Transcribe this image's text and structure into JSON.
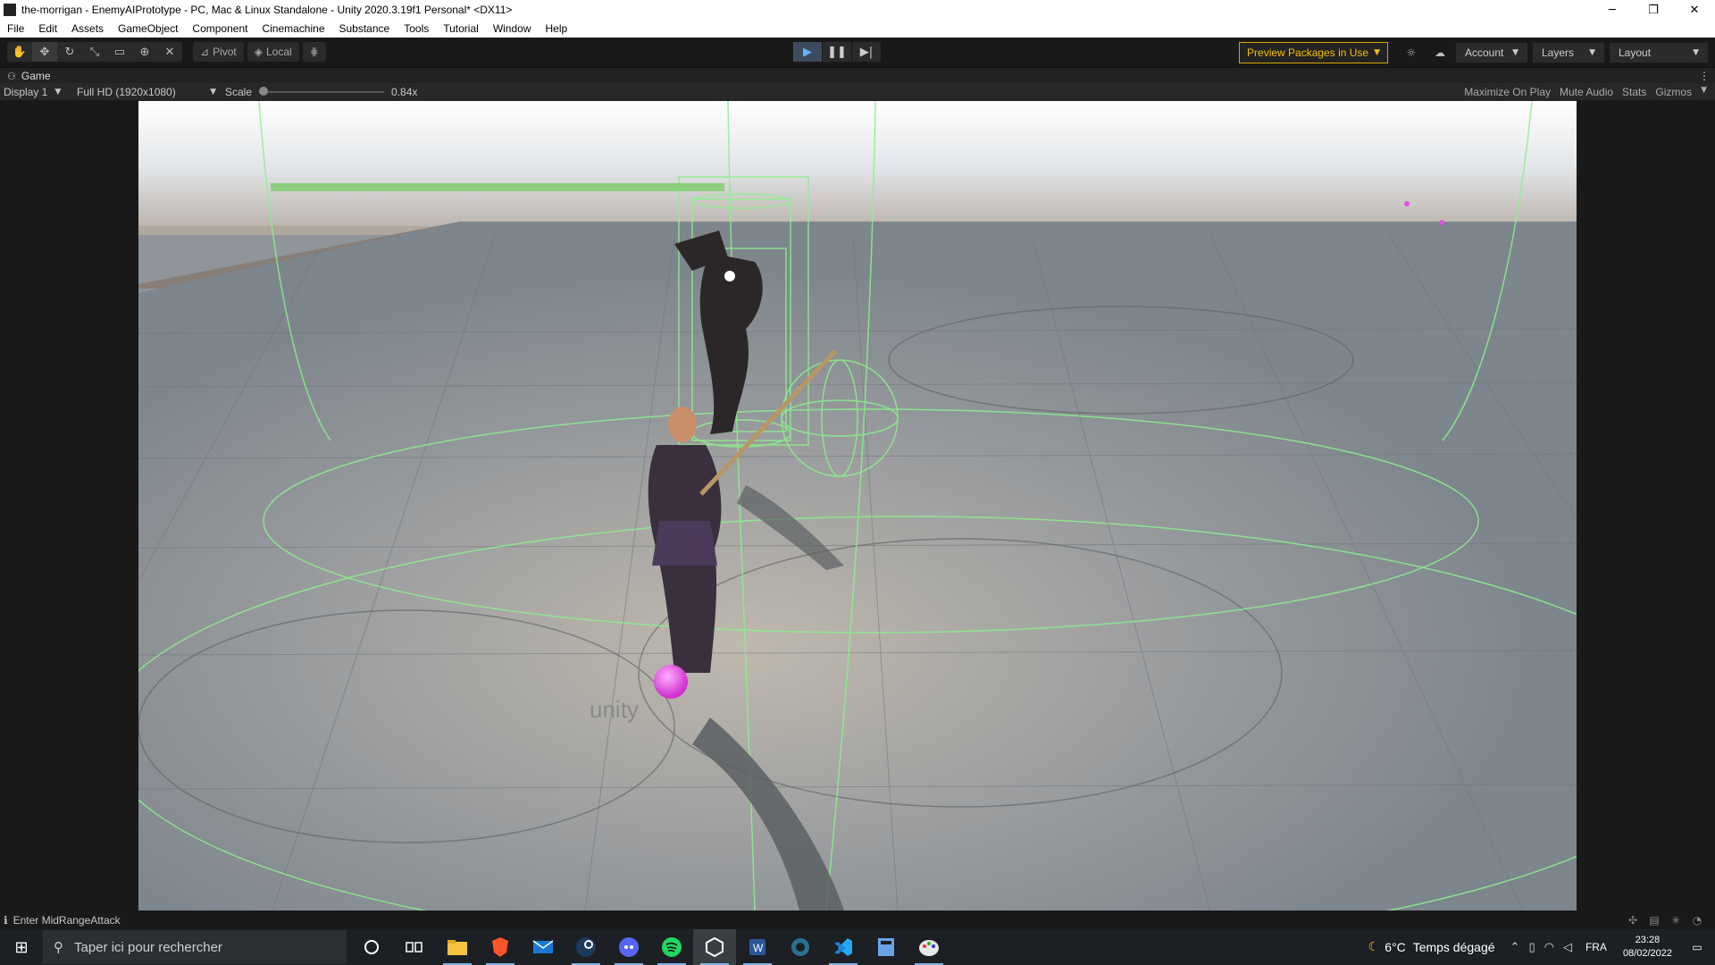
{
  "window": {
    "title": "the-morrigan - EnemyAIPrototype - PC, Mac & Linux Standalone - Unity 2020.3.19f1 Personal* <DX11>",
    "minimize_glyph": "─",
    "restore_glyph": "❐",
    "close_glyph": "✕"
  },
  "menu": [
    "File",
    "Edit",
    "Assets",
    "GameObject",
    "Component",
    "Cinemachine",
    "Substance",
    "Tools",
    "Tutorial",
    "Window",
    "Help"
  ],
  "toolbar": {
    "pivot_label": "Pivot",
    "local_label": "Local",
    "preview_packages_label": "Preview Packages in Use",
    "account_label": "Account",
    "layers_label": "Layers",
    "layout_label": "Layout"
  },
  "game_view": {
    "tab_label": "Game",
    "display_label": "Display 1",
    "resolution_label": "Full HD (1920x1080)",
    "scale_label": "Scale",
    "scale_value": "0.84x",
    "maximize_label": "Maximize On Play",
    "mute_label": "Mute Audio",
    "stats_label": "Stats",
    "gizmos_label": "Gizmos"
  },
  "scene": {
    "health_fraction": 1.0,
    "health_color": "#8ccf7e",
    "watermark_text": "unity"
  },
  "status": {
    "message": "Enter MidRangeAttack"
  },
  "taskbar": {
    "search_placeholder": "Taper ici pour rechercher",
    "weather_temp": "6°C",
    "weather_text": "Temps dégagé",
    "language": "FRA",
    "time": "23:28",
    "date": "08/02/2022"
  },
  "colors": {
    "accent_play": "#6ab0ff",
    "preview_packages": "#f3c000",
    "gizmo_green": "#7dff7d",
    "magenta": "#e050e0"
  }
}
